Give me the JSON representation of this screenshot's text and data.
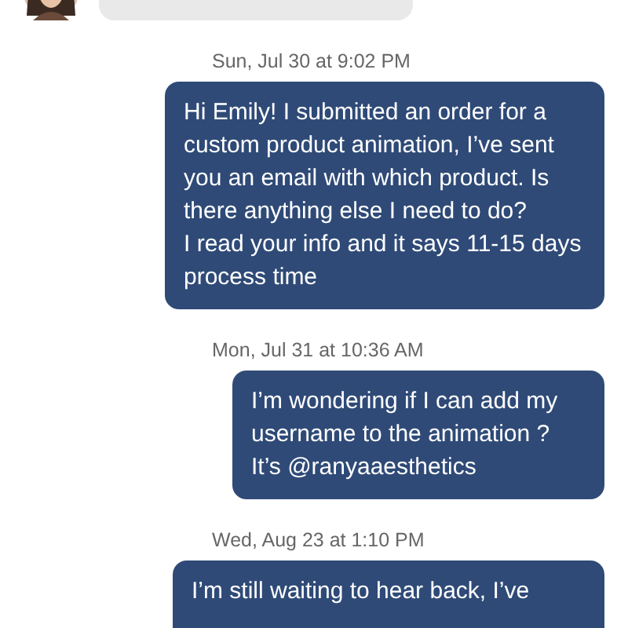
{
  "messages": [
    {
      "kind": "received"
    },
    {
      "kind": "sent",
      "time": "Sun, Jul 30 at 9:02 PM",
      "lines": [
        "Hi Emily! I submitted an order for a custom product animation, I’ve sent you an email with which product. Is there anything else I need to do?",
        "I read your info and it says 11-15 days process time"
      ]
    },
    {
      "kind": "sent",
      "time": "Mon, Jul 31 at 10:36 AM",
      "lines": [
        "I’m wondering if I can add my username to the animation ?",
        "It’s @ranyaaesthetics"
      ]
    },
    {
      "kind": "sent",
      "time": "Wed, Aug 23 at 1:10 PM",
      "lines": [
        "I’m still waiting to hear back, I’ve"
      ]
    }
  ]
}
